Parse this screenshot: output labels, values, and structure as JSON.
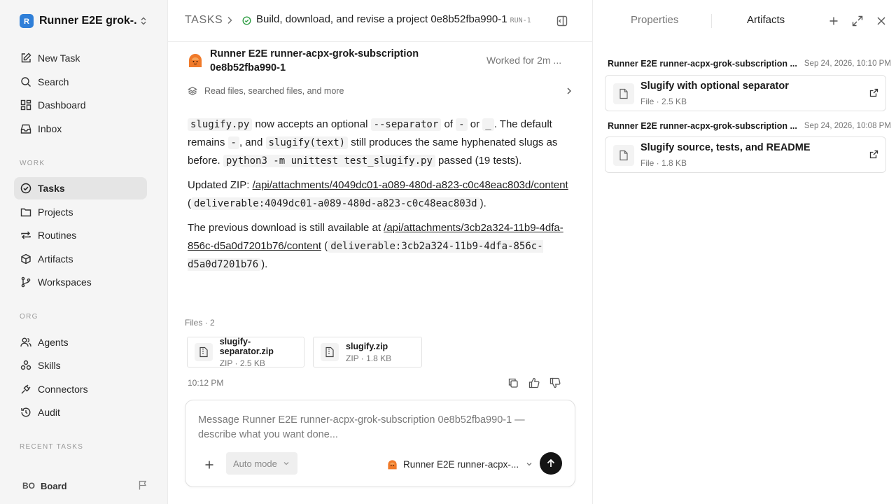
{
  "sidebar": {
    "workspace_name": "Runner E2E grok-...",
    "workspace_logo_icon": "r-logo-icon",
    "items_top": [
      {
        "label": "New Task",
        "icon": "edit-icon"
      },
      {
        "label": "Search",
        "icon": "search-icon"
      },
      {
        "label": "Dashboard",
        "icon": "dashboard-icon"
      },
      {
        "label": "Inbox",
        "icon": "inbox-icon"
      }
    ],
    "section_work": "WORK",
    "items_work": [
      {
        "label": "Tasks",
        "icon": "check-circle-icon",
        "active": true
      },
      {
        "label": "Projects",
        "icon": "folder-icon"
      },
      {
        "label": "Routines",
        "icon": "repeat-icon"
      },
      {
        "label": "Artifacts",
        "icon": "box-icon"
      },
      {
        "label": "Workspaces",
        "icon": "branch-icon"
      }
    ],
    "section_org": "ORG",
    "items_org": [
      {
        "label": "Agents",
        "icon": "users-icon"
      },
      {
        "label": "Skills",
        "icon": "skills-icon"
      },
      {
        "label": "Connectors",
        "icon": "plug-icon"
      },
      {
        "label": "Audit",
        "icon": "history-icon"
      }
    ],
    "section_recent": "RECENT TASKS",
    "board": {
      "initials": "BO",
      "label": "Board"
    }
  },
  "header": {
    "root": "TASKS",
    "title": "Build, download, and revise a project 0e8b52fba990-1",
    "run": "RUN-1"
  },
  "agent": {
    "name": "Runner E2E runner-acpx-grok-subscription 0e8b52fba990-1",
    "worked": "Worked for 2m ...",
    "activity": "Read files, searched files, and more"
  },
  "message": {
    "p1": {
      "c1": "slugify.py",
      "t1": " now accepts an optional ",
      "c2": "--separator",
      "t2": " of ",
      "c3": "-",
      "t3": " or ",
      "c4": "_",
      "t4": ". The default remains ",
      "c5": "-",
      "t5": ", and ",
      "c6": "slugify(text)",
      "t6": " still produces the same hyphenated slugs as before. ",
      "c7": "python3 -m unittest test_slugify.py",
      "t7": " passed (19 tests)."
    },
    "p2": {
      "t1": "Updated ZIP: ",
      "link": "/api/attachments/4049dc01-a089-480d-a823-c0c48eac803d/content",
      "t2": " (",
      "code": "deliverable:4049dc01-a089-480d-a823-c0c48eac803d",
      "t3": ")."
    },
    "p3": {
      "t1": "The previous download is still available at ",
      "link": "/api/attachments/3cb2a324-11b9-4dfa-856c-d5a0d7201b76/content",
      "t2": " (",
      "code": "deliverable:3cb2a324-11b9-4dfa-856c-d5a0d7201b76",
      "t3": ")."
    },
    "files_label": "Files · 2",
    "files": [
      {
        "name": "slugify-separator.zip",
        "meta": "ZIP · 2.5 KB"
      },
      {
        "name": "slugify.zip",
        "meta": "ZIP · 1.8 KB"
      }
    ],
    "time": "10:12 PM"
  },
  "composer": {
    "placeholder": "Message Runner E2E runner-acpx-grok-subscription 0e8b52fba990-1 — describe what you want done...",
    "mode": "Auto mode",
    "agent": "Runner E2E runner-acpx-..."
  },
  "right_panel": {
    "tab_properties": "Properties",
    "tab_artifacts": "Artifacts",
    "groups": [
      {
        "who": "Runner E2E runner-acpx-grok-subscription ...",
        "when": "Sep 24, 2026, 10:10 PM",
        "title": "Slugify with optional separator",
        "meta": "File · 2.5 KB"
      },
      {
        "who": "Runner E2E runner-acpx-grok-subscription ...",
        "when": "Sep 24, 2026, 10:08 PM",
        "title": "Slugify source, tests, and README",
        "meta": "File · 1.8 KB"
      }
    ]
  },
  "colors": {
    "accent": "#141414",
    "status_green": "#2f9e44",
    "logo_blue": "#2f7fd8",
    "avatar_orange": "#f07a2a"
  }
}
